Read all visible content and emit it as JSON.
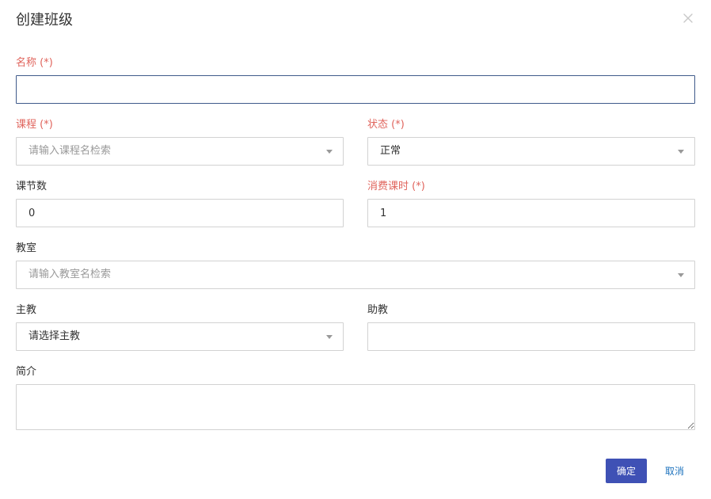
{
  "dialog": {
    "title": "创建班级",
    "close_icon": "close-icon"
  },
  "form": {
    "name": {
      "label": "名称 (*)",
      "value": "",
      "placeholder": ""
    },
    "course": {
      "label": "课程 (*)",
      "placeholder": "请输入课程名检索"
    },
    "status": {
      "label": "状态 (*)",
      "value": "正常"
    },
    "lesson_count": {
      "label": "课节数",
      "value": "0"
    },
    "consume_hours": {
      "label": "消费课时 (*)",
      "value": "1"
    },
    "classroom": {
      "label": "教室",
      "placeholder": "请输入教室名检索"
    },
    "main_teacher": {
      "label": "主教",
      "value": "请选择主教"
    },
    "assistant": {
      "label": "助教",
      "value": ""
    },
    "intro": {
      "label": "简介",
      "value": ""
    }
  },
  "footer": {
    "confirm_label": "确定",
    "cancel_label": "取消"
  },
  "colors": {
    "required_label": "#e0645c",
    "primary_button": "#3f51b5",
    "link": "#1e73be",
    "focus_border": "#3f5a8a"
  }
}
